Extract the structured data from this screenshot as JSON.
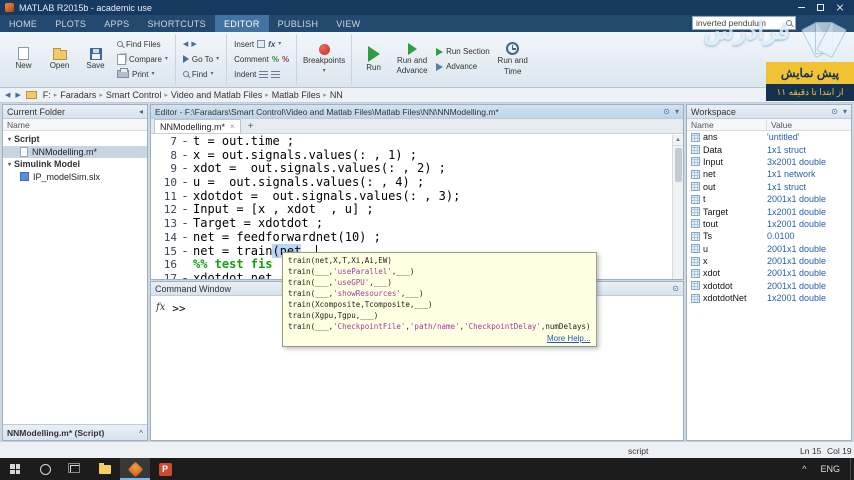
{
  "window": {
    "title": "MATLAB R2015b - academic use"
  },
  "ribbon_tabs": {
    "items": [
      "HOME",
      "PLOTS",
      "APPS",
      "SHORTCUTS",
      "EDITOR",
      "PUBLISH",
      "VIEW"
    ],
    "active": "EDITOR"
  },
  "search": {
    "value": "inverted pendulum"
  },
  "toolbar": {
    "file": {
      "new": "New",
      "open": "Open",
      "save": "Save",
      "find_files": "Find Files",
      "compare": "Compare",
      "print": "Print"
    },
    "navigate": {
      "go_to": "Go To",
      "find": "Find"
    },
    "edit": {
      "insert": "Insert",
      "comment": "Comment",
      "indent": "Indent"
    },
    "breakpoints": {
      "label": "Breakpoints"
    },
    "run": {
      "run": "Run",
      "run_and_advance_line1": "Run and",
      "run_and_advance_line2": "Advance",
      "run_section": "Run Section",
      "advance": "Advance",
      "run_and_time_line1": "Run and",
      "run_and_time_line2": "Time"
    }
  },
  "breadcrumb": {
    "separator": "▸",
    "segments": [
      "F:",
      "Faradars",
      "Smart Control",
      "Video and Matlab Files",
      "Matlab Files",
      "NN"
    ]
  },
  "current_folder": {
    "title": "Current Folder",
    "column": "Name",
    "detail": "NNModelling.m* (Script)",
    "groups": [
      {
        "label": "Script",
        "items": [
          {
            "name": "NNModelling.m*",
            "icon": "mfile",
            "selected": true
          }
        ]
      },
      {
        "label": "Simulink Model",
        "items": [
          {
            "name": "IP_modelSim.slx",
            "icon": "slx",
            "selected": false
          }
        ]
      }
    ]
  },
  "editor": {
    "title": "Editor - F:\\Faradars\\Smart Control\\Video and Matlab Files\\Matlab Files\\NN\\NNModelling.m*",
    "tab_label": "NNModelling.m*",
    "lines": [
      {
        "no": "7",
        "dash": "-",
        "code": "t = out.time ;"
      },
      {
        "no": "8",
        "dash": "-",
        "code": "x = out.signals.values(: , 1) ;"
      },
      {
        "no": "9",
        "dash": "-",
        "code": "xdot =  out.signals.values(: , 2) ;"
      },
      {
        "no": "10",
        "dash": "-",
        "code": "u =  out.signals.values(: , 4) ;"
      },
      {
        "no": "11",
        "dash": "-",
        "code": "xdotdot =  out.signals.values(: , 3);"
      },
      {
        "no": "12",
        "dash": "-",
        "code": "Input = [x , xdot  , u] ;"
      },
      {
        "no": "13",
        "dash": "-",
        "code": "Target = xdotdot ;"
      },
      {
        "no": "14",
        "dash": "-",
        "code": "net = feedforwardnet(10) ;"
      },
      {
        "no": "15",
        "dash": "-",
        "segments": [
          {
            "t": "net = train"
          },
          {
            "t": "(net",
            "c": "hl"
          },
          {
            "t": " ,"
          }
        ],
        "caret": true
      },
      {
        "no": "16",
        "dash": "",
        "type": "comment",
        "code": "%% test fis"
      },
      {
        "no": "17",
        "dash": "-",
        "code": "xdotdot_net"
      }
    ]
  },
  "popup": {
    "signatures": [
      [
        {
          "t": "train(net,X,T,Xi,Ai,EW)"
        }
      ],
      [
        {
          "t": "train(___,"
        },
        {
          "t": "'useParallel'",
          "c": "pstr"
        },
        {
          "t": ",___)"
        }
      ],
      [
        {
          "t": "train(___,"
        },
        {
          "t": "'useGPU'",
          "c": "pstr"
        },
        {
          "t": ",___)"
        }
      ],
      [
        {
          "t": "train(___,"
        },
        {
          "t": "'showResources'",
          "c": "pstr"
        },
        {
          "t": ",___)"
        }
      ],
      [
        {
          "t": "train(Xcomposite,Tcomposite,___)"
        }
      ],
      [
        {
          "t": "train(Xgpu,Tgpu,___)"
        }
      ],
      [
        {
          "t": "train(___,"
        },
        {
          "t": "'CheckpointFile'",
          "c": "pstr"
        },
        {
          "t": ","
        },
        {
          "t": "'path/name'",
          "c": "pstr"
        },
        {
          "t": ","
        },
        {
          "t": "'CheckpointDelay'",
          "c": "pstr"
        },
        {
          "t": ",numDelays)"
        }
      ]
    ],
    "more_help": "More Help..."
  },
  "command_window": {
    "title": "Command Window",
    "fx": "fx",
    "prompt": ">>"
  },
  "workspace": {
    "title": "Workspace",
    "columns": [
      "Name",
      "Value"
    ],
    "rows": [
      {
        "name": "ans",
        "value": "'untitled'"
      },
      {
        "name": "Data",
        "value": "1x1 struct"
      },
      {
        "name": "Input",
        "value": "3x2001 double"
      },
      {
        "name": "net",
        "value": "1x1 network"
      },
      {
        "name": "out",
        "value": "1x1 struct"
      },
      {
        "name": "t",
        "value": "2001x1 double"
      },
      {
        "name": "Target",
        "value": "1x2001 double"
      },
      {
        "name": "tout",
        "value": "1x2001 double"
      },
      {
        "name": "Ts",
        "value": "0.0100"
      },
      {
        "name": "u",
        "value": "2001x1 double"
      },
      {
        "name": "x",
        "value": "2001x1 double"
      },
      {
        "name": "xdot",
        "value": "2001x1 double"
      },
      {
        "name": "xdotdot",
        "value": "2001x1 double"
      },
      {
        "name": "xdotdotNet",
        "value": "1x2001 double"
      }
    ]
  },
  "status": {
    "script": "script",
    "ln": "Ln 15",
    "col": "Col 19"
  },
  "taskbar": {
    "lang": "ENG",
    "powerpoint_letter": "P"
  },
  "overlay": {
    "preview": "پیش نمایش",
    "subtitle": "از ابتدا تا دقیقه ۱۱",
    "brand": "فرادرس"
  },
  "icons": {
    "dock": "⊙",
    "dropdown": "▾",
    "collapse_left": "◂",
    "chevron_up": "^",
    "close_tab": "×",
    "new_tab": "+",
    "scroll_up": "▲",
    "scroll_down": "▼",
    "back": "◀",
    "forward": "▶",
    "fx": "fx",
    "percent": "%",
    "group_triangle": "▾"
  },
  "colors": {
    "titlebar": "#16395f",
    "active_tab": "#4273a3",
    "run_green": "#2f9e3f",
    "breakpoint_red": "#c22d20",
    "popup_bg": "#ffffe1",
    "preview_yellow": "#f2c235",
    "overlay_navy": "#14324f",
    "value_blue": "#2a5db0",
    "comment_green": "#11a011"
  }
}
